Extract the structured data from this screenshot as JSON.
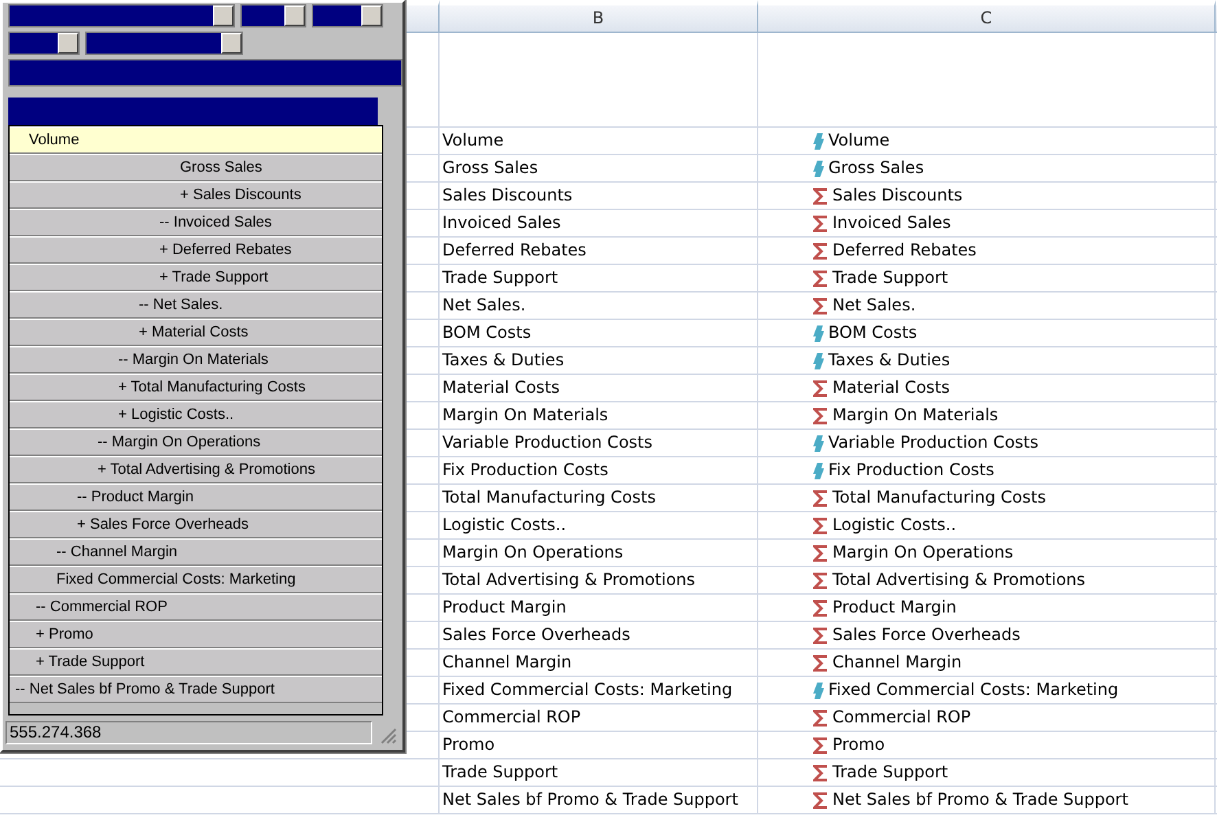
{
  "panel": {
    "list": [
      {
        "label": "Volume",
        "selected": true
      },
      {
        "label": "-- Net Sales bf Promo & Trade Support",
        "selected": false,
        "children": [
          {
            "label": "-- Commercial ROP",
            "selected": false,
            "children": [
              {
                "label": "-- Channel Margin",
                "selected": false,
                "children": [
                  {
                    "label": "-- Product Margin",
                    "selected": false,
                    "children": [
                      {
                        "label": "-- Margin On Operations",
                        "selected": false,
                        "children": [
                          {
                            "label": "-- Margin On Materials",
                            "selected": false,
                            "children": [
                              {
                                "label": "-- Net Sales.",
                                "selected": false,
                                "children": [
                                  {
                                    "label": "-- Invoiced Sales",
                                    "selected": false,
                                    "children": [
                                      {
                                        "label": "Gross Sales",
                                        "selected": false
                                      },
                                      {
                                        "label": "+ Sales Discounts",
                                        "selected": false
                                      }
                                    ]
                                  },
                                  {
                                    "label": "+ Deferred Rebates",
                                    "selected": false
                                  },
                                  {
                                    "label": "+ Trade Support",
                                    "selected": false
                                  }
                                ]
                              },
                              {
                                "label": "+ Material Costs",
                                "selected": false
                              }
                            ]
                          },
                          {
                            "label": "+ Total Manufacturing Costs",
                            "selected": false
                          },
                          {
                            "label": "+ Logistic Costs..",
                            "selected": false
                          }
                        ]
                      },
                      {
                        "label": "+ Total Advertising & Promotions",
                        "selected": false
                      }
                    ]
                  },
                  {
                    "label": "+ Sales Force Overheads",
                    "selected": false
                  }
                ]
              },
              {
                "label": "Fixed Commercial Costs: Marketing",
                "selected": false
              }
            ]
          },
          {
            "label": "+ Promo",
            "selected": false
          },
          {
            "label": "+ Trade Support",
            "selected": false
          }
        ]
      }
    ],
    "status": "555.274.368"
  },
  "sheet": {
    "columns": [
      "B",
      "C"
    ],
    "rows": [
      {
        "b": "Volume",
        "c": "Volume",
        "kind": "input"
      },
      {
        "b": "Gross Sales",
        "c": "Gross Sales",
        "kind": "input"
      },
      {
        "b": "Sales Discounts",
        "c": "Sales Discounts",
        "kind": "sum"
      },
      {
        "b": "Invoiced Sales",
        "c": "Invoiced Sales",
        "kind": "sum"
      },
      {
        "b": "Deferred Rebates",
        "c": "Deferred Rebates",
        "kind": "sum"
      },
      {
        "b": "Trade Support",
        "c": "Trade Support",
        "kind": "sum"
      },
      {
        "b": "Net Sales.",
        "c": "Net Sales.",
        "kind": "sum"
      },
      {
        "b": "BOM Costs",
        "c": "BOM Costs",
        "kind": "input"
      },
      {
        "b": "Taxes & Duties",
        "c": "Taxes & Duties",
        "kind": "input"
      },
      {
        "b": "Material Costs",
        "c": "Material Costs",
        "kind": "sum"
      },
      {
        "b": "Margin On Materials",
        "c": "Margin On Materials",
        "kind": "sum"
      },
      {
        "b": "Variable Production Costs",
        "c": "Variable Production Costs",
        "kind": "input"
      },
      {
        "b": "Fix Production Costs",
        "c": "Fix Production Costs",
        "kind": "input"
      },
      {
        "b": "Total Manufacturing Costs",
        "c": "Total Manufacturing Costs",
        "kind": "sum"
      },
      {
        "b": "Logistic Costs..",
        "c": "Logistic Costs..",
        "kind": "sum"
      },
      {
        "b": "Margin On Operations",
        "c": "Margin On Operations",
        "kind": "sum"
      },
      {
        "b": "Total Advertising & Promotions",
        "c": "Total Advertising & Promotions",
        "kind": "sum"
      },
      {
        "b": "Product Margin",
        "c": "Product Margin",
        "kind": "sum"
      },
      {
        "b": "Sales Force Overheads",
        "c": "Sales Force Overheads",
        "kind": "sum"
      },
      {
        "b": "Channel Margin",
        "c": "Channel Margin",
        "kind": "sum"
      },
      {
        "b": "Fixed Commercial Costs: Marketing",
        "c": "Fixed Commercial Costs: Marketing",
        "kind": "input"
      },
      {
        "b": "Commercial ROP",
        "c": "Commercial ROP",
        "kind": "sum"
      },
      {
        "b": "Promo",
        "c": "Promo",
        "kind": "sum"
      },
      {
        "b": "Trade Support",
        "c": "Trade Support",
        "kind": "sum"
      },
      {
        "b": "Net Sales bf Promo & Trade Support",
        "c": "Net Sales bf Promo & Trade Support",
        "kind": "sum"
      }
    ]
  }
}
